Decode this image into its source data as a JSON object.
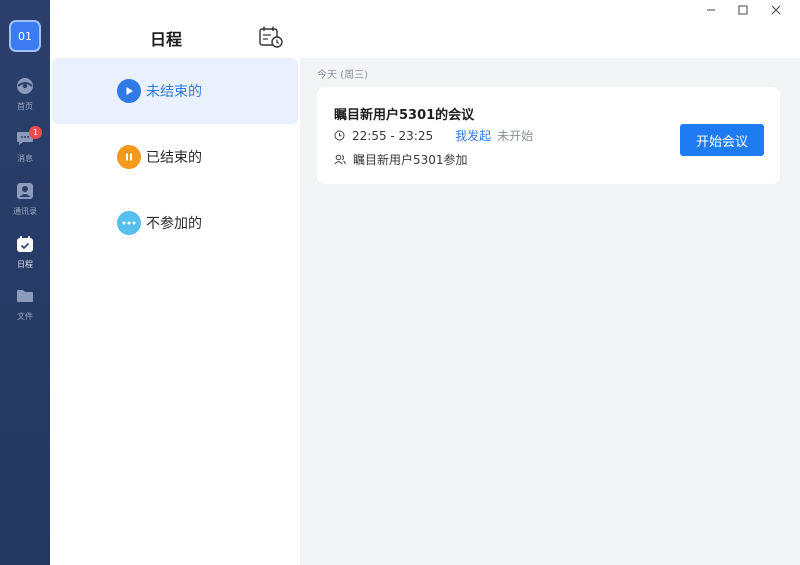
{
  "sidebar": {
    "avatar_text": "01",
    "items": [
      {
        "label": "首页",
        "icon": "home-icon"
      },
      {
        "label": "消息",
        "icon": "message-icon",
        "badge": "1"
      },
      {
        "label": "通讯录",
        "icon": "contacts-icon"
      },
      {
        "label": "日程",
        "icon": "calendar-icon",
        "active": true
      },
      {
        "label": "文件",
        "icon": "folder-icon"
      }
    ]
  },
  "schedule_panel": {
    "title": "日程",
    "categories": [
      {
        "label": "未结束的",
        "icon": "play-icon",
        "color": "#2f7ae5",
        "selected": true
      },
      {
        "label": "已结束的",
        "icon": "pause-icon",
        "color": "#f39a1a"
      },
      {
        "label": "不参加的",
        "icon": "more-icon",
        "color": "#56bff0"
      }
    ]
  },
  "main": {
    "date_header": "今天 (周三)",
    "meeting": {
      "title": "瞩目新用户5301的会议",
      "time": "22:55 - 23:25",
      "initiator": "我发起",
      "status": "未开始",
      "participants": "瞩目新用户5301参加",
      "start_button": "开始会议"
    }
  },
  "colors": {
    "accent": "#1f7bf2",
    "rail": "#23375f",
    "selected_bg": "#e8f1fd"
  }
}
